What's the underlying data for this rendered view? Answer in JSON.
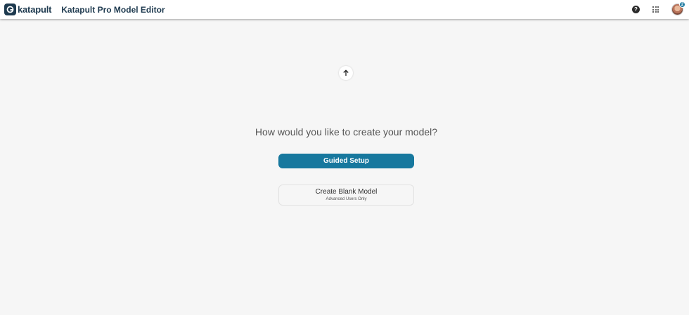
{
  "header": {
    "logo_text": "katapult",
    "app_title": "Katapult Pro Model Editor",
    "help_icon_glyph": "?",
    "avatar_badge": "2"
  },
  "main": {
    "question": "How would you like to create your model?",
    "guided_setup_label": "Guided Setup",
    "blank_model_label": "Create Blank Model",
    "blank_model_sublabel": "Advanced Users Only"
  },
  "colors": {
    "brand": "#1e3a4f",
    "accent": "#17789e",
    "background": "#f6f6f6"
  },
  "icons": [
    "katapult-logo-icon",
    "help-icon",
    "apps-grid-icon",
    "avatar",
    "arrow-up-icon"
  ]
}
